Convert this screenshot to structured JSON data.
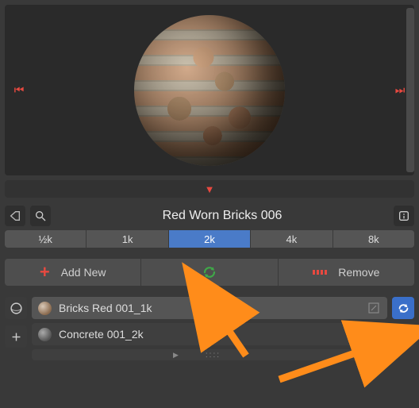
{
  "preview": {
    "material_name": "Red Worn Bricks 006"
  },
  "resolutions": {
    "options": [
      "½k",
      "1k",
      "2k",
      "4k",
      "8k"
    ],
    "active": "2k"
  },
  "actions": {
    "add_label": "Add New",
    "remove_label": "Remove"
  },
  "material_list": {
    "items": [
      {
        "label": "Bricks Red 001_1k",
        "swatch": "brick",
        "selected": true
      },
      {
        "label": "Concrete 001_2k",
        "swatch": "concrete",
        "selected": false
      }
    ]
  },
  "colors": {
    "accent_red": "#e84940",
    "accent_blue": "#4a7bc8",
    "refresh_green": "#3fa848",
    "arrow_orange": "#ff8c1a"
  }
}
